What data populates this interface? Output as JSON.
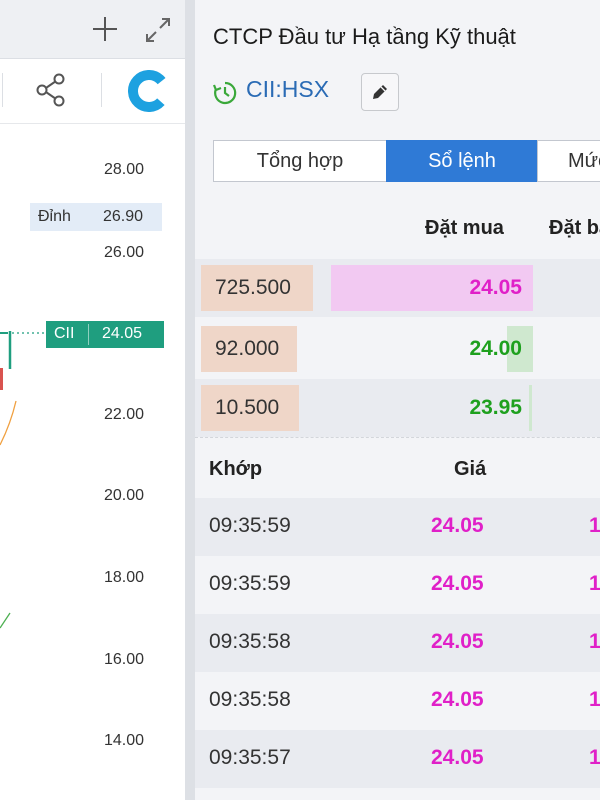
{
  "chart_panel": {
    "axis_ticks": [
      "28.00",
      "26.00",
      "22.00",
      "20.00",
      "18.00",
      "16.00",
      "14.00"
    ],
    "peak": {
      "label": "Đỉnh",
      "value": "26.90"
    },
    "price_marker": {
      "symbol": "CII",
      "value": "24.05"
    },
    "colors": {
      "marker": "#1f9e7f",
      "logo": "#1da1e0"
    }
  },
  "detail_panel": {
    "company_name": "CTCP Đầu tư Hạ tầng Kỹ thuật",
    "ticker": "CII:HSX",
    "tabs": [
      {
        "label": "Tổng hợp",
        "active": false
      },
      {
        "label": "Sổ lệnh",
        "active": true
      },
      {
        "label": "Mức",
        "active": false
      }
    ],
    "order_book": {
      "headers": {
        "bid": "Đặt mua",
        "ask": "Đặt bán"
      },
      "rows": [
        {
          "volume": "725.500",
          "price": "24.05",
          "price_color": "#e020c8"
        },
        {
          "volume": "92.000",
          "price": "24.00",
          "price_color": "#1ea01e"
        },
        {
          "volume": "10.500",
          "price": "23.95",
          "price_color": "#1ea01e"
        }
      ]
    },
    "trades": {
      "headers": {
        "time": "Khớp",
        "price": "Giá"
      },
      "rows": [
        {
          "time": "09:35:59",
          "price": "24.05",
          "volume": "1"
        },
        {
          "time": "09:35:59",
          "price": "24.05",
          "volume": "1"
        },
        {
          "time": "09:35:58",
          "price": "24.05",
          "volume": "1"
        },
        {
          "time": "09:35:58",
          "price": "24.05",
          "volume": "1"
        },
        {
          "time": "09:35:57",
          "price": "24.05",
          "volume": "1"
        }
      ]
    },
    "colors": {
      "accent": "#2f7ad6",
      "ceiling": "#e020c8",
      "up": "#1ea01e",
      "ticker": "#2a6bb5"
    }
  }
}
